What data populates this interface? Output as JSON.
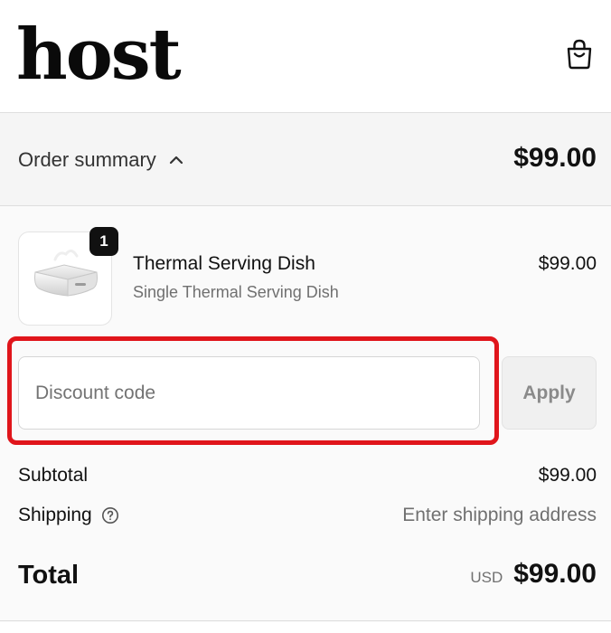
{
  "header": {
    "logo_text": "host",
    "cart_icon": "shopping-bag-icon"
  },
  "summary": {
    "toggle_label": "Order summary",
    "toggle_icon": "chevron-up-icon",
    "total": "$99.00"
  },
  "line_item": {
    "quantity": "1",
    "name": "Thermal Serving Dish",
    "variant": "Single Thermal Serving Dish",
    "price": "$99.00"
  },
  "discount": {
    "placeholder": "Discount code",
    "value": "",
    "apply_label": "Apply"
  },
  "totals": {
    "subtotal_label": "Subtotal",
    "subtotal_value": "$99.00",
    "shipping_label": "Shipping",
    "shipping_help_icon": "help-circle-icon",
    "shipping_value": "Enter shipping address",
    "total_label": "Total",
    "currency": "USD",
    "total_value": "$99.00"
  },
  "colors": {
    "highlight": "#e0151b",
    "summary_bg": "#f5f5f5",
    "content_bg": "#fafafa"
  }
}
